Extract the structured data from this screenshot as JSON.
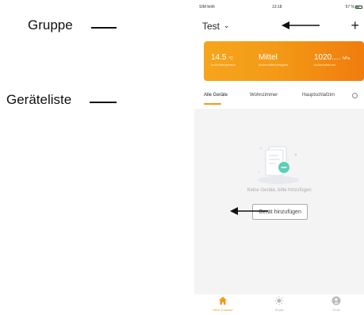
{
  "annotations": {
    "gruppe": "Gruppe",
    "geraeteliste": "Geräteliste"
  },
  "status_bar": {
    "carrier": "SIM fehlt",
    "time": "13:18",
    "battery": "57 %"
  },
  "header": {
    "group_name": "Test"
  },
  "weather": [
    {
      "value": "14.5",
      "unit": "°C",
      "label": "Außentemperatur"
    },
    {
      "value": "Mittel",
      "unit": "",
      "label": "Außenluftfeuchtigkeit"
    },
    {
      "value": "1020....",
      "unit": "hPa",
      "label": "Außenluftdruck"
    }
  ],
  "tabs": [
    "Alle Geräte",
    "Wohnzimmer",
    "Hauptschlafzim"
  ],
  "empty_state": {
    "message": "Keine Geräte, bitte hinzufügen",
    "button_label": "Gerät hinzufügen"
  },
  "bottom_nav": [
    {
      "label": "Mein Zuhause",
      "icon": "home-icon",
      "active": true
    },
    {
      "label": "Smart",
      "icon": "sun-icon",
      "active": false
    },
    {
      "label": "Profil",
      "icon": "profile-icon",
      "active": false
    }
  ],
  "colors": {
    "accent": "#f39a16",
    "card_gradient_start": "#f6a51c",
    "card_gradient_end": "#f07c0e",
    "content_background": "#f4f4f5"
  }
}
